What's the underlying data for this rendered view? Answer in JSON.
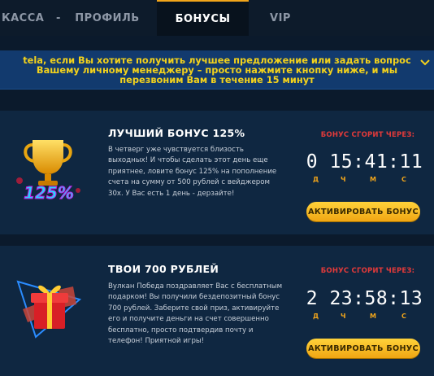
{
  "nav": {
    "kassa": "КАССА",
    "separator": "-",
    "profile": "ПРОФИЛЬ",
    "bonus": "БОНУСЫ",
    "vip": "VIP",
    "active_tab": "БОНУСЫ"
  },
  "banner": {
    "text": "tela, если Вы хотите получить лучшее предложение или задать вопрос Вашему личному менеджеру – просто нажмите кнопку ниже, и мы перезвоним Вам в течение 15 минут"
  },
  "bonuses": [
    {
      "title": "ЛУЧШИЙ БОНУС 125%",
      "image_label": "125%",
      "description": "В четверг уже чувствуется близость выходных! И чтобы сделать этот день еще приятнее, ловите бонус 125% на пополнение счета на сумму от 500 рублей с вейджером 30х. У Вас есть 1 день - дерзайте!",
      "expire_label": "БОНУС СГОРИТ ЧЕРЕЗ:",
      "timer": "0 15:41:11",
      "units": {
        "d": "Д",
        "h": "Ч",
        "m": "М",
        "s": "С"
      },
      "button": "АКТИВИРОВАТЬ БОНУС"
    },
    {
      "title": "ТВОИ 700 РУБЛЕЙ",
      "description": "Вулкан Победа поздравляет Вас с бесплатным подарком! Вы получили бездепозитный бонус 700 рублей. Заберите свой приз, активируйте его и получите деньги на счет совершенно бесплатно, просто подтвердив почту и телефон! Приятной игры!",
      "expire_label": "БОНУС СГОРИТ ЧЕРЕЗ:",
      "timer": "2 23:58:13",
      "units": {
        "d": "Д",
        "h": "Ч",
        "m": "М",
        "s": "С"
      },
      "button": "АКТИВИРОВАТЬ БОНУС"
    }
  ],
  "colors": {
    "background": "#0b1a2c",
    "card": "#0f2741",
    "banner": "#123a6e",
    "banner_text": "#f3d21c",
    "accent": "#f2a51a",
    "expire_red": "#e33a3a"
  },
  "icons": {
    "banner_chevron": "chevron-down-icon",
    "bonus1_image": "trophy-125-icon",
    "bonus2_image": "gift-box-icon"
  }
}
